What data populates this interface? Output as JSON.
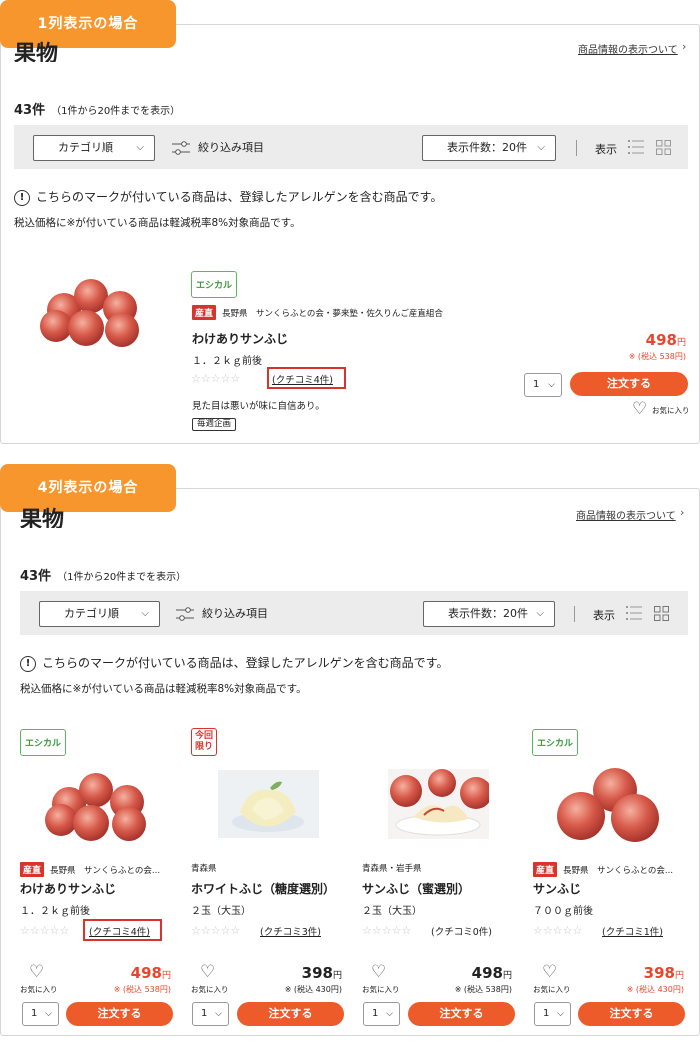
{
  "section1": {
    "badge": "1列表示の場合",
    "title": "果物",
    "info_link": "商品情報の表示ついて",
    "count_main": "43件",
    "count_sub": "（1件から20件までを表示）",
    "sort_label": "カテゴリ順",
    "filter_label": "絞り込み項目",
    "per_page_label": "表示件数：20件",
    "display_label": "表示",
    "notice": "こちらのマークが付いている商品は、登録したアレルゲンを含む商品です。",
    "tax_note": "税込価格に※が付いている商品は軽減税率8%対象商品です。",
    "product": {
      "tag": "エシカル",
      "sanchoku": "産直",
      "origin": "長野県　サンくらふとの会・夢来塾・佐久りんご産直組合",
      "name": "わけありサンふじ",
      "qty": "１．２ｋｇ前後",
      "review": "(クチコミ4件)",
      "desc": "見た目は悪いが味に自信あり。",
      "weekly": "毎週企画",
      "price": "498",
      "yen": "円",
      "tax_included": "※ (税込 538円)",
      "quantity": "1",
      "order_label": "注文する",
      "fav_label": "お気に入り"
    }
  },
  "section2": {
    "badge": "4列表示の場合",
    "title": "果物",
    "info_link": "商品情報の表示ついて",
    "count_main": "43件",
    "count_sub": "（1件から20件までを表示）",
    "sort_label": "カテゴリ順",
    "filter_label": "絞り込み項目",
    "per_page_label": "表示件数：20件",
    "display_label": "表示",
    "notice": "こちらのマークが付いている商品は、登録したアレルゲンを含む商品です。",
    "tax_note": "税込価格に※が付いている商品は軽減税率8%対象商品です。",
    "products": [
      {
        "tag": "エシカル",
        "sanchoku": "産直",
        "origin": "長野県　サンくらふとの会...",
        "name": "わけありサンふじ",
        "qty": "１．２ｋｇ前後",
        "review": "(クチコミ4件)",
        "price": "498",
        "yen": "円",
        "tax_included": "※ (税込 538円)",
        "quantity": "1",
        "order_label": "注文する",
        "fav_label": "お気に入り"
      },
      {
        "tag_line1": "今回",
        "tag_line2": "限り",
        "origin": "青森県",
        "name": "ホワイトふじ（糖度選別）",
        "qty": "２玉（大玉）",
        "review": "(クチコミ3件)",
        "price": "398",
        "yen": "円",
        "tax_included": "※ (税込 430円)",
        "quantity": "1",
        "order_label": "注文する",
        "fav_label": "お気に入り"
      },
      {
        "origin": "青森県・岩手県",
        "name": "サンふじ（蜜選別）",
        "qty": "２玉（大玉）",
        "review": "(クチコミ0件)",
        "price": "498",
        "yen": "円",
        "tax_included": "※ (税込 538円)",
        "quantity": "1",
        "order_label": "注文する",
        "fav_label": "お気に入り"
      },
      {
        "tag": "エシカル",
        "sanchoku": "産直",
        "origin": "長野県　サンくらふとの会...",
        "name": "サンふじ",
        "qty": "７００ｇ前後",
        "review": "(クチコミ1件)",
        "price": "398",
        "yen": "円",
        "tax_included": "※ (税込 430円)",
        "quantity": "1",
        "order_label": "注文する",
        "fav_label": "お気に入り"
      }
    ]
  },
  "colors": {
    "accent": "#f7962d",
    "order": "#ee5b2b",
    "price_red": "#e8452c",
    "ethical_green": "#5cb85c",
    "sanchoku_red": "#d9342b"
  }
}
